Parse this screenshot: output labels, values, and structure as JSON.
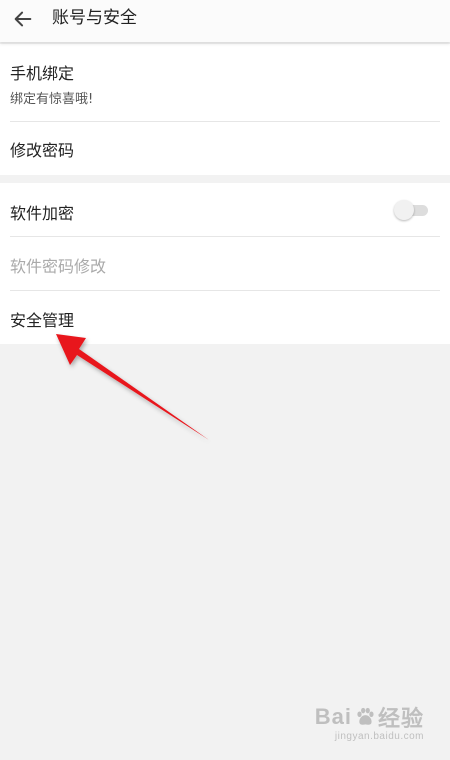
{
  "header": {
    "title": "账号与安全",
    "back_icon": "arrow-left-icon"
  },
  "groups": [
    {
      "items": [
        {
          "title": "手机绑定",
          "subtitle": "绑定有惊喜哦!"
        },
        {
          "title": "修改密码"
        }
      ]
    },
    {
      "items": [
        {
          "title": "软件加密",
          "toggle_on": false
        },
        {
          "title": "软件密码修改",
          "disabled": true
        },
        {
          "title": "安全管理"
        }
      ]
    }
  ],
  "annotation": {
    "arrow_color": "#e8141b",
    "points_to": "安全管理"
  },
  "watermark": {
    "brand_left": "Bai",
    "brand_right": "经验",
    "site": "jingyan.baidu.com"
  },
  "colors": {
    "background": "#f2f2f2",
    "card": "#ffffff",
    "text": "#222222",
    "disabled_text": "#aaaaaa",
    "divider": "#e6e6e6"
  }
}
